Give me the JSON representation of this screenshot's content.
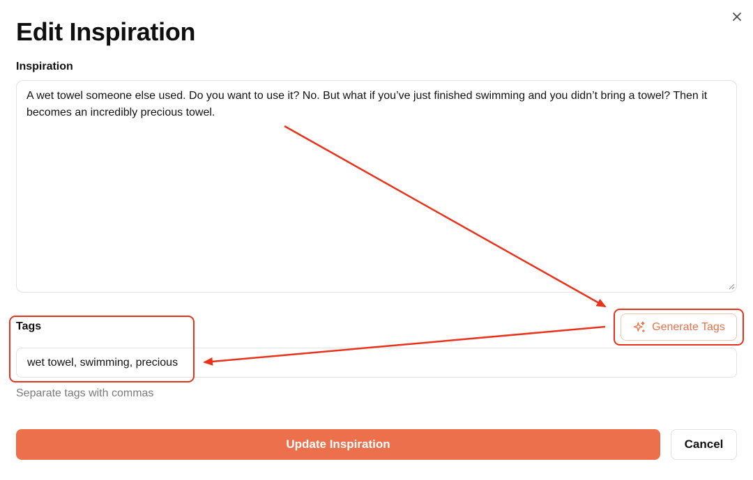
{
  "dialog": {
    "title": "Edit Inspiration",
    "close_icon": "close-icon"
  },
  "inspiration": {
    "label": "Inspiration",
    "value": "A wet towel someone else used. Do you want to use it? No. But what if you’ve just finished swimming and you didn’t bring a towel? Then it becomes an incredibly precious towel."
  },
  "tags": {
    "label": "Tags",
    "value": "wet towel, swimming, precious",
    "hint": "Separate tags with commas"
  },
  "generate_button": {
    "label": "Generate Tags",
    "icon": "sparkles-icon"
  },
  "actions": {
    "update_label": "Update Inspiration",
    "cancel_label": "Cancel"
  },
  "colors": {
    "accent": "#ec704b",
    "annotation": "#e8321c"
  }
}
